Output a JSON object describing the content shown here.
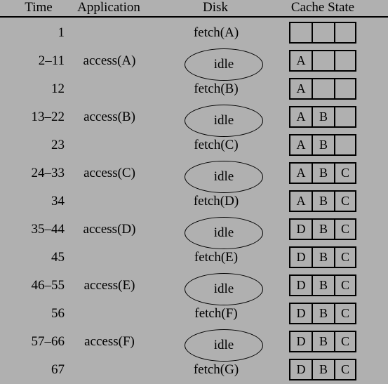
{
  "figure": {
    "title": "Cache state timeline table",
    "background_color": "#b0b0b0",
    "rule_color": "#000000"
  },
  "header": {
    "time": "Time",
    "application": "Application",
    "disk": "Disk",
    "cache_state": "Cache State"
  },
  "rows": [
    {
      "time": "1",
      "application": "",
      "disk": "fetch(A)",
      "disk_kind": "fetch",
      "cache": [
        "",
        "",
        ""
      ]
    },
    {
      "time": "2–11",
      "application": "access(A)",
      "disk": "idle",
      "disk_kind": "idle",
      "cache": [
        "A",
        "",
        ""
      ]
    },
    {
      "time": "12",
      "application": "",
      "disk": "fetch(B)",
      "disk_kind": "fetch",
      "cache": [
        "A",
        "",
        ""
      ]
    },
    {
      "time": "13–22",
      "application": "access(B)",
      "disk": "idle",
      "disk_kind": "idle",
      "cache": [
        "A",
        "B",
        ""
      ]
    },
    {
      "time": "23",
      "application": "",
      "disk": "fetch(C)",
      "disk_kind": "fetch",
      "cache": [
        "A",
        "B",
        ""
      ]
    },
    {
      "time": "24–33",
      "application": "access(C)",
      "disk": "idle",
      "disk_kind": "idle",
      "cache": [
        "A",
        "B",
        "C"
      ]
    },
    {
      "time": "34",
      "application": "",
      "disk": "fetch(D)",
      "disk_kind": "fetch",
      "cache": [
        "A",
        "B",
        "C"
      ]
    },
    {
      "time": "35–44",
      "application": "access(D)",
      "disk": "idle",
      "disk_kind": "idle",
      "cache": [
        "D",
        "B",
        "C"
      ]
    },
    {
      "time": "45",
      "application": "",
      "disk": "fetch(E)",
      "disk_kind": "fetch",
      "cache": [
        "D",
        "B",
        "C"
      ]
    },
    {
      "time": "46–55",
      "application": "access(E)",
      "disk": "idle",
      "disk_kind": "idle",
      "cache": [
        "D",
        "B",
        "C"
      ]
    },
    {
      "time": "56",
      "application": "",
      "disk": "fetch(F)",
      "disk_kind": "fetch",
      "cache": [
        "D",
        "B",
        "C"
      ]
    },
    {
      "time": "57–66",
      "application": "access(F)",
      "disk": "idle",
      "disk_kind": "idle",
      "cache": [
        "D",
        "B",
        "C"
      ]
    },
    {
      "time": "67",
      "application": "",
      "disk": "fetch(G)",
      "disk_kind": "fetch",
      "cache": [
        "D",
        "B",
        "C"
      ]
    }
  ]
}
